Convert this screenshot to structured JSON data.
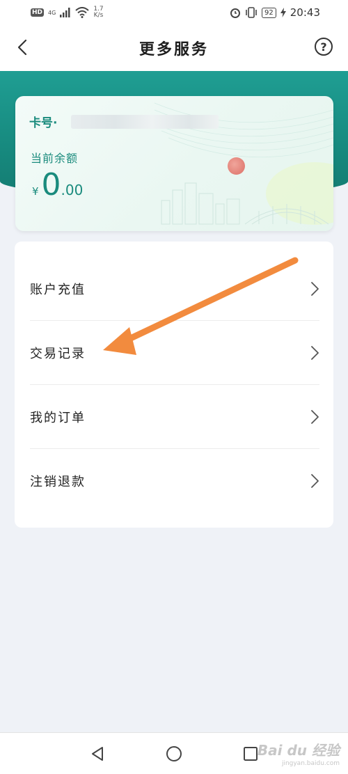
{
  "status_bar": {
    "hd_badge": "HD",
    "network": "4G",
    "speed_value": "1.7",
    "speed_unit": "K/s",
    "battery": "92",
    "time": "20:43",
    "icons": [
      "signal-icon",
      "wifi-icon",
      "alarm-icon",
      "vibrate-icon",
      "battery-icon",
      "charging-icon"
    ]
  },
  "header": {
    "title": "更多服务",
    "back_icon": "chevron-left-icon",
    "help_label": "?"
  },
  "card": {
    "card_no_label": "卡号·",
    "balance_label": "当前余额",
    "currency": "¥",
    "balance_int": "0",
    "balance_dec": ".00"
  },
  "menu": {
    "items": [
      {
        "label": "账户充值"
      },
      {
        "label": "交易记录"
      },
      {
        "label": "我的订单"
      },
      {
        "label": "注销退款"
      }
    ]
  },
  "annotation": {
    "color": "#f28b3e",
    "icon": "arrow-icon"
  },
  "nav": {
    "icons": [
      "back-triangle-icon",
      "home-circle-icon",
      "recent-square-icon"
    ]
  },
  "watermark": {
    "text": "Bai du 经验",
    "sub": "jingyan.baidu.com"
  },
  "colors": {
    "accent": "#1a8b7d",
    "band": "#178a7f",
    "background": "#eff2f7"
  }
}
